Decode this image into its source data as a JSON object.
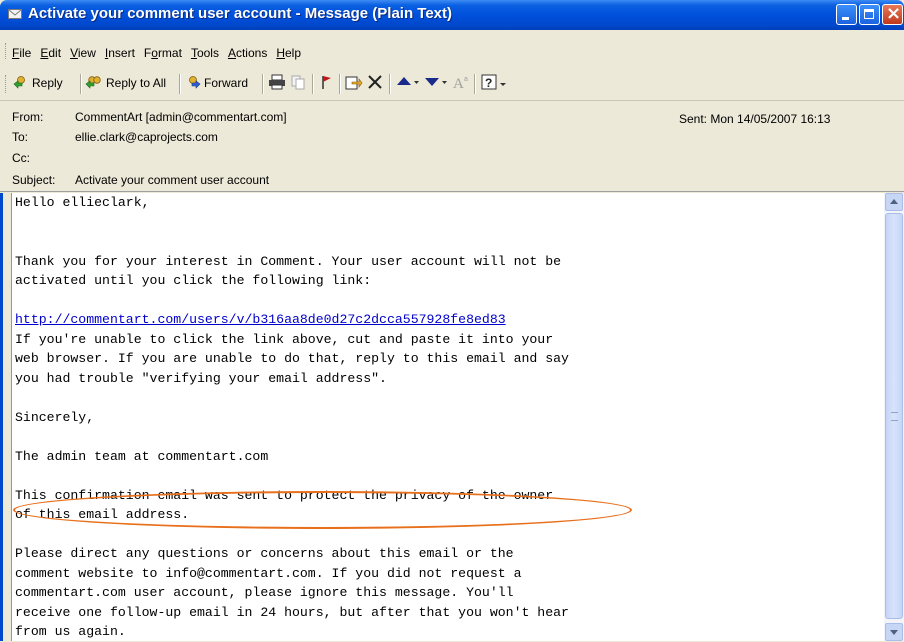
{
  "window": {
    "title": "Activate your comment user account - Message (Plain Text)",
    "icon": "envelope-icon"
  },
  "menu": {
    "items": [
      {
        "label": "File",
        "accel": "F"
      },
      {
        "label": "Edit",
        "accel": "E"
      },
      {
        "label": "View",
        "accel": "V"
      },
      {
        "label": "Insert",
        "accel": "I"
      },
      {
        "label": "Format",
        "accel": "o"
      },
      {
        "label": "Tools",
        "accel": "T"
      },
      {
        "label": "Actions",
        "accel": "A"
      },
      {
        "label": "Help",
        "accel": "H"
      }
    ]
  },
  "toolbar": {
    "reply_label": "Reply",
    "reply_all_label": "Reply to All",
    "forward_label": "Forward"
  },
  "header": {
    "from_label": "From:",
    "from_value": "CommentArt [admin@commentart.com]",
    "to_label": "To:",
    "to_value": "ellie.clark@caprojects.com",
    "cc_label": "Cc:",
    "cc_value": "",
    "subject_label": "Subject:",
    "subject_value": "Activate your comment user account",
    "sent_label": "Sent:",
    "sent_value": "Mon 14/05/2007 16:13"
  },
  "body": {
    "greeting": "Hello ellieclark,",
    "para1_line1": "Thank you for your interest in Comment. Your user account will not be",
    "para1_line2": "activated until you click the following link:",
    "link": "http://commentart.com/users/v/b316aa8de0d27c2dcca557928fe8ed83",
    "para2_line1": "If you're unable to click the link above, cut and paste it into your",
    "para2_line2": "web browser. If you are unable to do that, reply to this email and say",
    "para2_line3": "you had trouble \"verifying your email address\".",
    "signoff": "Sincerely,",
    "team": "The admin team at commentart.com",
    "para3_line1": "This confirmation email was sent to protect the privacy of the owner",
    "para3_line2": "of this email address.",
    "para4_line1": "Please direct any questions or concerns about this email or the",
    "para4_line2": "comment website to info@commentart.com. If you did not request a",
    "para4_line3": "commentart.com user account, please ignore this message. You'll",
    "para4_line4": "receive one follow-up email in 24 hours, but after that you won't hear",
    "para4_line5": "from us again."
  },
  "colors": {
    "titlebar": "#0050dc",
    "link": "#0000cc",
    "annotation_circle": "#e8701c"
  }
}
